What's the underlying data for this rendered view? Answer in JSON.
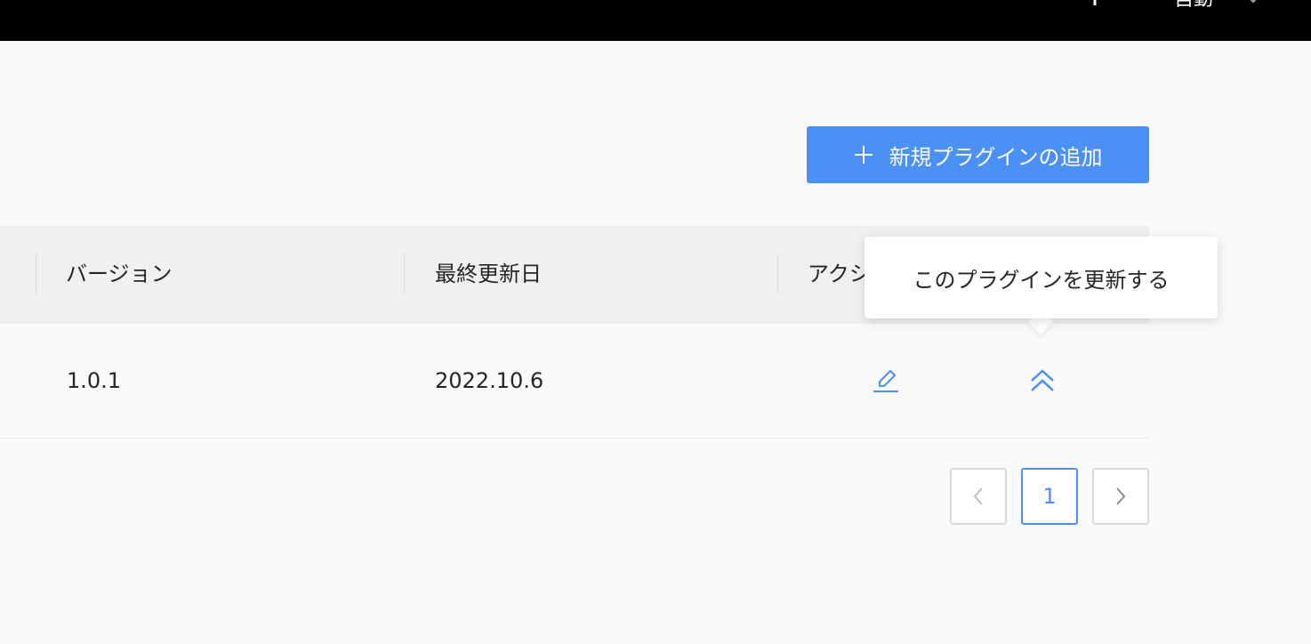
{
  "topbar": {
    "language_label": "自動"
  },
  "toolbar": {
    "add_button_label": "新規プラグインの追加"
  },
  "table": {
    "columns": [
      "バージョン",
      "最終更新日",
      "アクション"
    ],
    "rows": [
      {
        "version": "1.0.1",
        "updated": "2022.10.6"
      }
    ]
  },
  "tooltip": {
    "text": "このプラグインを更新する"
  },
  "pagination": {
    "current_page": "1"
  },
  "colors": {
    "accent": "#4a90f5",
    "header_bg": "#f0f0f0",
    "topbar_bg": "#000000"
  },
  "icons": [
    "cloud-upload-icon",
    "chevron-down-icon",
    "plus-icon",
    "edit-icon",
    "double-chevron-up-icon",
    "chevron-left-icon",
    "chevron-right-icon"
  ]
}
